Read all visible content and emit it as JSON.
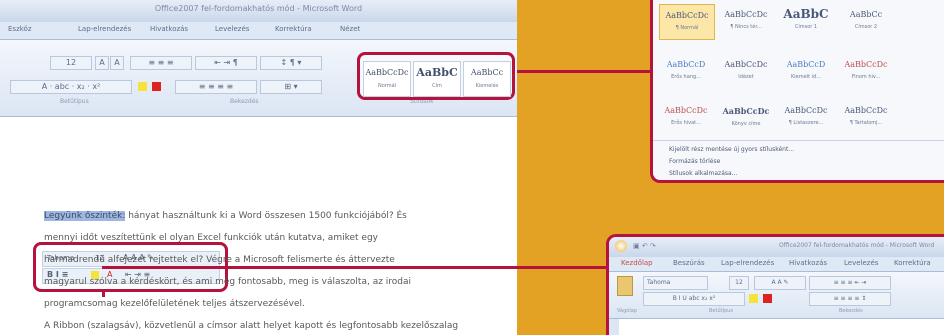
{
  "left_window": {
    "title": "Office2007 fel-fordomakhatós mód - Microsoft Word",
    "tabs": [
      "Eszköz",
      "Lap-elrendezés",
      "Hivatkozás",
      "Levelezés",
      "Korrektúra",
      "Nézet"
    ],
    "font_size": "12",
    "groups": [
      "Betűtípus",
      "Bekezdés",
      "Stílusok"
    ],
    "styles": [
      {
        "sample": "AaBbCcDc",
        "name": "Normál"
      },
      {
        "sample": "AaBbC",
        "name": "Cím"
      },
      {
        "sample": "AaBbCc",
        "name": "Kiemelés"
      }
    ]
  },
  "mini_toolbar": {
    "font": "Tahoma",
    "size": "12"
  },
  "document": {
    "lines": [
      {
        "highlight": "Legyünk őszinték:",
        "rest": " hányat használtunk ki a Word összesen 1500 funkciójából? És"
      },
      {
        "highlight": "",
        "rest": "mennyi időt veszítettünk el olyan Excel funkciók után kutatva, amiket egy"
      },
      {
        "highlight": "",
        "rest": "harmadrendű alfejezet rejtettek el? Végre a Microsoft felismerte és áttervezte"
      },
      {
        "highlight": "",
        "rest": "magyarul szólva a kérdéskört, és ami még fontosabb, meg is válaszolta, az irodai"
      },
      {
        "highlight": "",
        "rest": "programcsomag kezelőfelületének teljes átszervezésével."
      },
      {
        "highlight": "",
        "rest": "A Ribbon (szalagsáv), közvetlenül a címsor alatt helyet kapott és legfontosabb kezelőszalag"
      }
    ]
  },
  "style_gallery": {
    "rows": [
      [
        {
          "sample": "AaBbCcDc",
          "name": "¶ Normál"
        },
        {
          "sample": "AaBbCcDc",
          "name": "¶ Nincs tér..."
        },
        {
          "sample": "AaBbC",
          "name": "Címsor 1"
        },
        {
          "sample": "AaBbCc",
          "name": "Címsor 2"
        }
      ],
      [
        {
          "sample": "AaBbCcD",
          "name": "Erős hang..."
        },
        {
          "sample": "AaBbCcDc",
          "name": "Idézet"
        },
        {
          "sample": "AaBbCcD",
          "name": "Kiemelt id..."
        },
        {
          "sample": "AaBbCcDc",
          "name": "Finom hiv..."
        }
      ],
      [
        {
          "sample": "AaBbCcDc",
          "name": "Erős hivat..."
        },
        {
          "sample": "AaBbCcDc",
          "name": "Könyv címe"
        },
        {
          "sample": "AaBbCcDc",
          "name": "¶ Listaszere..."
        },
        {
          "sample": "AaBbCcDc",
          "name": "¶ Tartalomj..."
        }
      ]
    ],
    "menu": [
      "Kijelölt rész mentése új gyors stílusként...",
      "Formázás törlése",
      "Stílusok alkalmazása..."
    ]
  },
  "right_window": {
    "title": "Office2007 fel-fordomakhatós mód - Microsoft Word",
    "tabs": [
      "Kezdőlap",
      "Beszúrás",
      "Lap-elrendezés",
      "Hivatkozás",
      "Levelezés",
      "Korrektúra"
    ],
    "font": "Tahoma",
    "font_size": "12",
    "groups": [
      "Vágólap",
      "Betűtípus",
      "Bekezdés"
    ]
  },
  "colors": {
    "background": "#e3a224",
    "callout": "#b5123e",
    "ribbon": "#dbe5f3"
  }
}
